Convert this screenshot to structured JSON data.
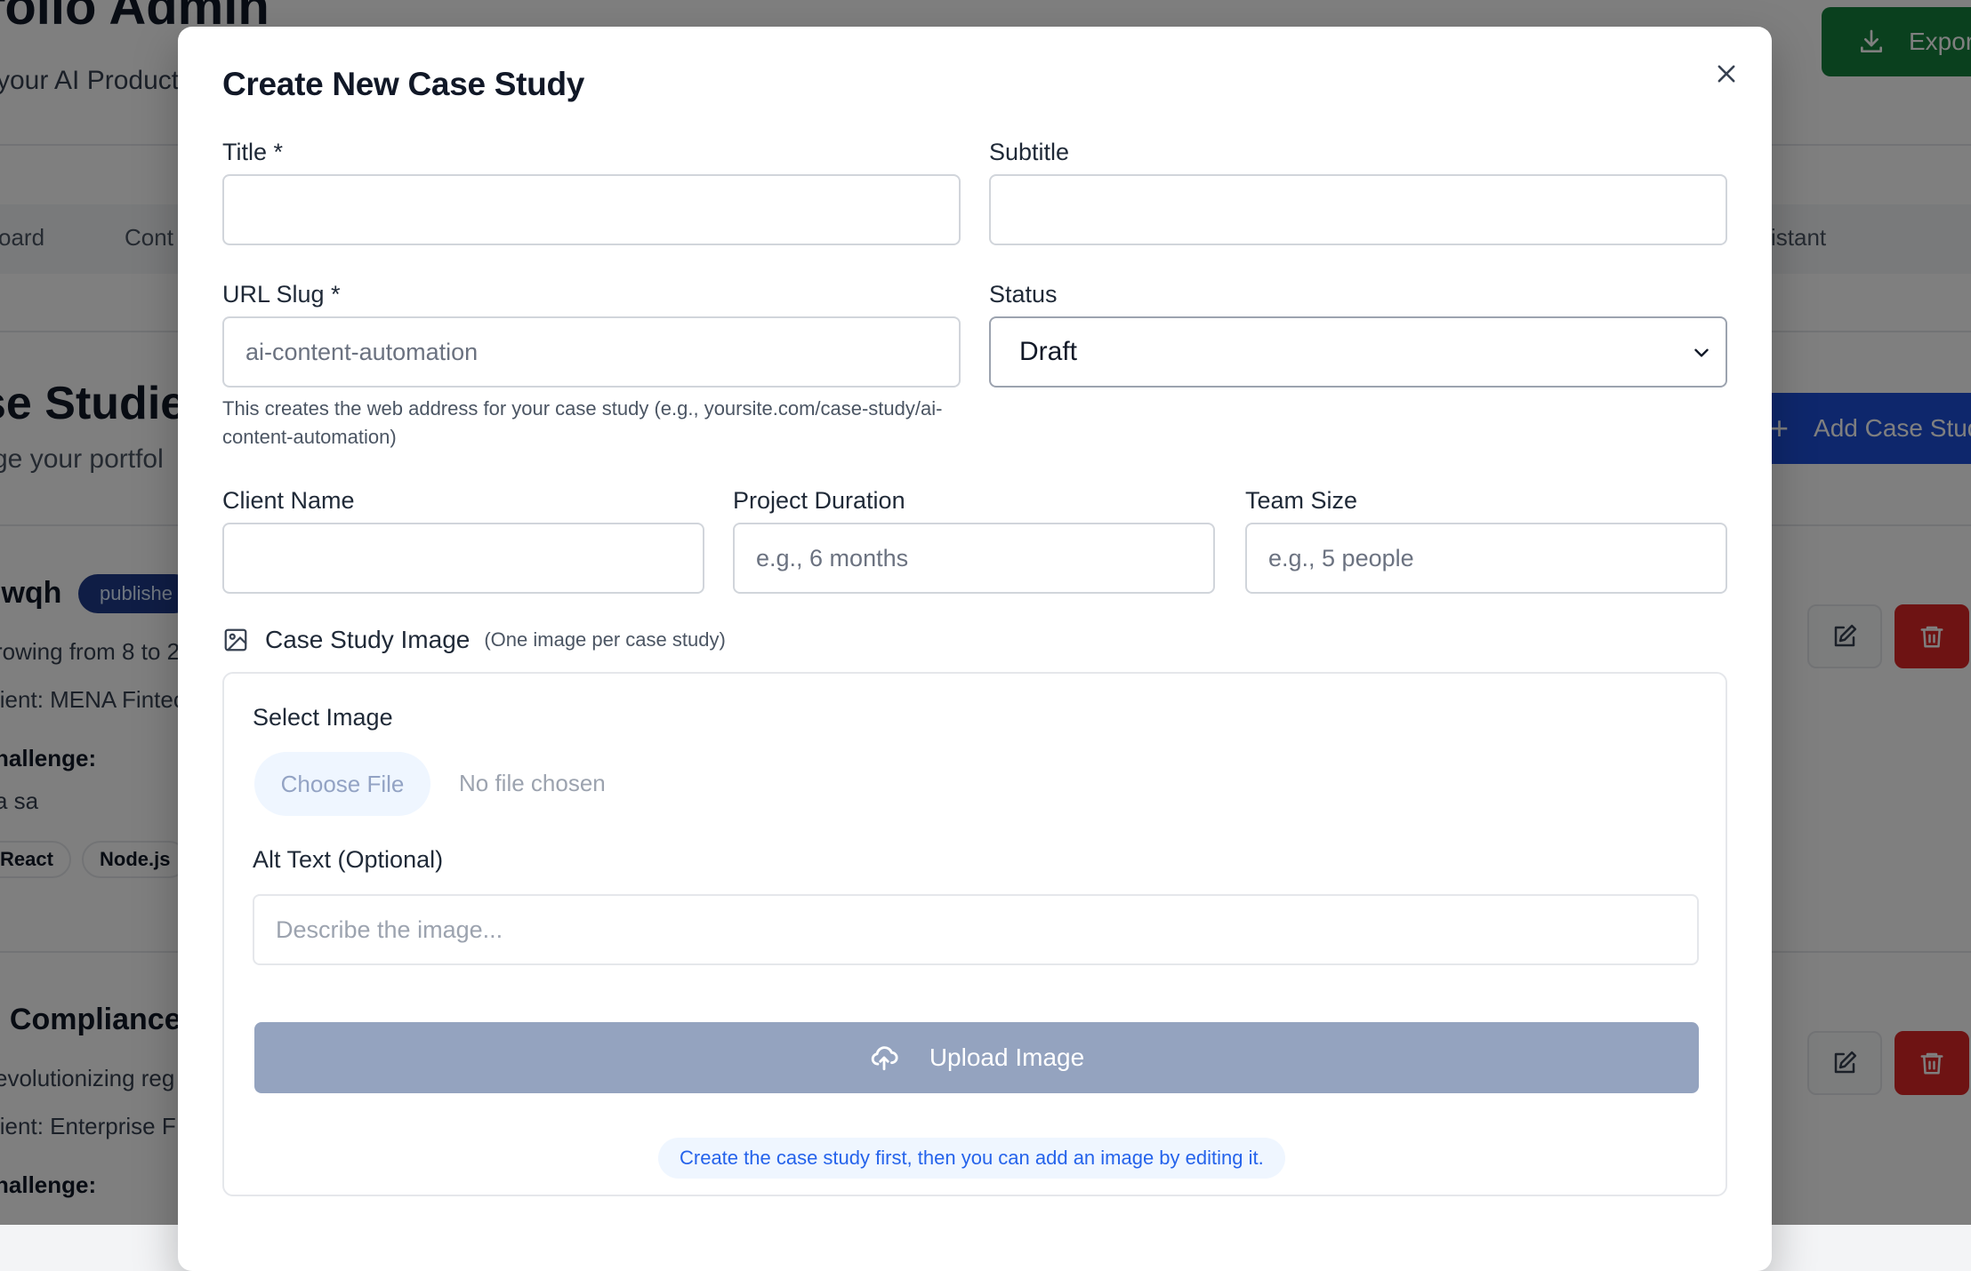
{
  "background": {
    "app_title": "folio Admin",
    "app_subtitle": "your AI Product",
    "export_label": "Export",
    "tabs": [
      "oard",
      "Cont",
      "sistant"
    ],
    "section_title": "se Studie",
    "section_subtitle": "ge your portfol",
    "add_label": "Add Case Stud",
    "cards": [
      {
        "title": "iwqh",
        "badge": "publishe",
        "line1": "rowing from 8 to 2",
        "client": "lient: MENA Fintec",
        "challenge_label": "hallenge:",
        "challenge_text": "a sa",
        "chips": [
          "React",
          "Node.js"
        ]
      },
      {
        "title": "I Compliance R",
        "line1": "evolutionizing reg",
        "client": "lient: Enterprise F",
        "challenge_label": "hallenge:"
      }
    ]
  },
  "modal": {
    "title": "Create New Case Study",
    "fields": {
      "title": {
        "label": "Title *",
        "value": "",
        "placeholder": ""
      },
      "subtitle": {
        "label": "Subtitle",
        "value": "",
        "placeholder": ""
      },
      "slug": {
        "label": "URL Slug *",
        "placeholder": "ai-content-automation",
        "help": "This creates the web address for your case study (e.g., yoursite.com/case-study/ai-content-automation)"
      },
      "status": {
        "label": "Status",
        "selected": "Draft"
      },
      "client": {
        "label": "Client Name",
        "placeholder": ""
      },
      "duration": {
        "label": "Project Duration",
        "placeholder": "e.g., 6 months"
      },
      "team": {
        "label": "Team Size",
        "placeholder": "e.g., 5 people"
      }
    },
    "image_section": {
      "heading": "Case Study Image",
      "note": "(One image per case study)",
      "select_label": "Select Image",
      "choose_button": "Choose File",
      "no_file": "No file chosen",
      "alt_label": "Alt Text (Optional)",
      "alt_placeholder": "Describe the image...",
      "upload_button": "Upload Image",
      "info": "Create the case study first, then you can add an image by editing it."
    }
  },
  "colors": {
    "overlay": "rgba(0,0,0,0.5)",
    "upload_button": "#94a3bf",
    "info_text": "#2563eb",
    "export_green": "#15803d",
    "delete_red": "#dc2626"
  }
}
